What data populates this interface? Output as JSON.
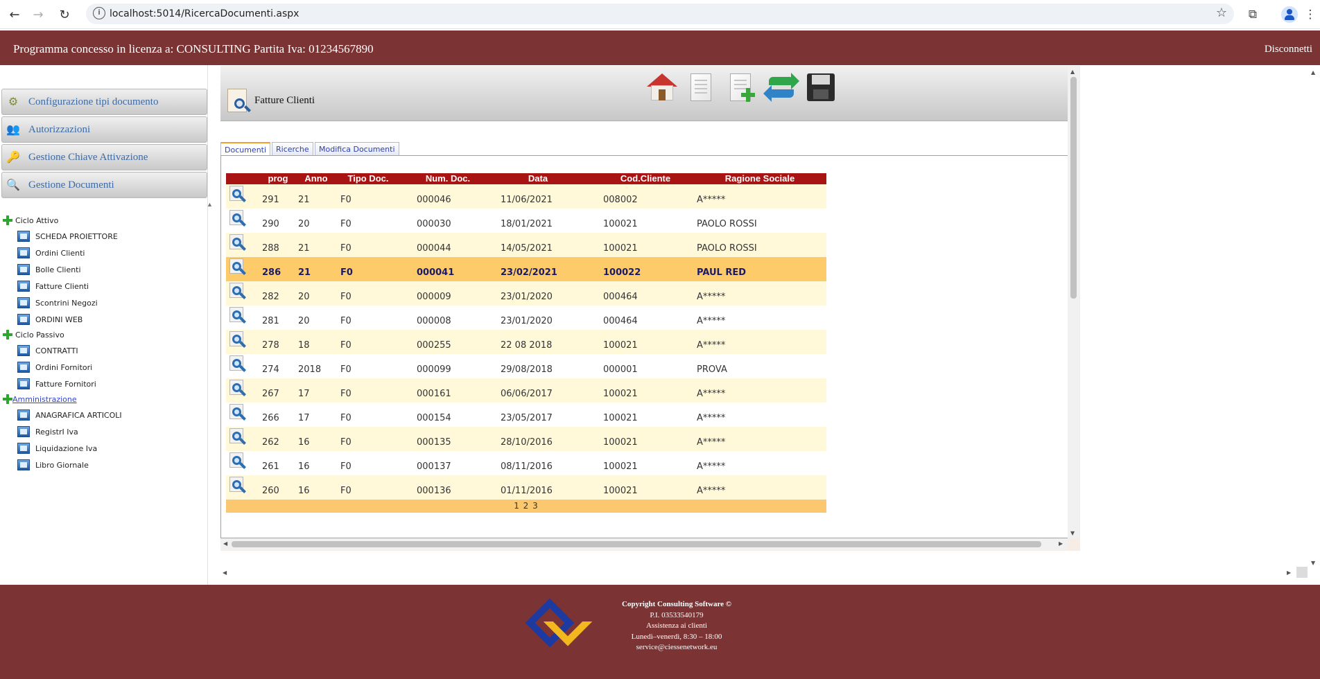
{
  "browser": {
    "url": "localhost:5014/RicercaDocumenti.aspx"
  },
  "header": {
    "license_text": "Programma concesso in licenza a: CONSULTING Partita Iva: 01234567890",
    "logout_label": "Disconnetti"
  },
  "sidebar": {
    "menu": [
      {
        "label": "Configurazione tipi documento",
        "icon": "gear-icon"
      },
      {
        "label": "Autorizzazioni",
        "icon": "users-icon"
      },
      {
        "label": "Gestione Chiave Attivazione",
        "icon": "key-icon"
      },
      {
        "label": "Gestione Documenti",
        "icon": "search-document-icon"
      }
    ],
    "groups": [
      {
        "label": "Ciclo Attivo",
        "items": [
          "SCHEDA PROIETTORE",
          "Ordini Clienti",
          "Bolle Clienti",
          "Fatture Clienti",
          "Scontrini Negozi",
          "ORDINI WEB"
        ]
      },
      {
        "label": "Ciclo Passivo",
        "items": [
          "CONTRATTI",
          "Ordini Fornitori",
          "Fatture Fornitori"
        ]
      },
      {
        "label": "Amministrazione",
        "items": [
          "ANAGRAFICA ARTICOLI",
          "RegistrI Iva",
          "Liquidazione Iva",
          "Libro Giornale"
        ]
      }
    ]
  },
  "page": {
    "title": "Fatture Clienti",
    "toolbar": [
      "home-icon",
      "new-document-icon",
      "add-document-icon",
      "refresh-icon",
      "save-icon"
    ]
  },
  "tabs": [
    {
      "label": "Documenti",
      "active": true
    },
    {
      "label": "Ricerche",
      "active": false
    },
    {
      "label": "Modifica Documenti",
      "active": false
    }
  ],
  "table": {
    "columns": [
      "prog",
      "Anno",
      "Tipo Doc.",
      "Num. Doc.",
      "Data",
      "Cod.Cliente",
      "Ragione Sociale"
    ],
    "rows": [
      [
        "291",
        "21",
        "F0",
        "000046",
        "11/06/2021",
        "008002",
        "A*****"
      ],
      [
        "290",
        "20",
        "F0",
        "000030",
        "18/01/2021",
        "100021",
        "PAOLO ROSSI"
      ],
      [
        "288",
        "21",
        "F0",
        "000044",
        "14/05/2021",
        "100021",
        "PAOLO ROSSI"
      ],
      [
        "286",
        "21",
        "F0",
        "000041",
        "23/02/2021",
        "100022",
        "PAUL RED"
      ],
      [
        "282",
        "20",
        "F0",
        "000009",
        "23/01/2020",
        "000464",
        "A*****"
      ],
      [
        "281",
        "20",
        "F0",
        "000008",
        "23/01/2020",
        "000464",
        "A*****"
      ],
      [
        "278",
        "18",
        "F0",
        "000255",
        "22 08 2018",
        "100021",
        "A*****"
      ],
      [
        "274",
        "2018",
        "F0",
        "000099",
        "29/08/2018",
        "000001",
        "PROVA"
      ],
      [
        "267",
        "17",
        "F0",
        "000161",
        "06/06/2017",
        "100021",
        "A*****"
      ],
      [
        "266",
        "17",
        "F0",
        "000154",
        "23/05/2017",
        "100021",
        "A*****"
      ],
      [
        "262",
        "16",
        "F0",
        "000135",
        "28/10/2016",
        "100021",
        "A*****"
      ],
      [
        "261",
        "16",
        "F0",
        "000137",
        "08/11/2016",
        "100021",
        "A*****"
      ],
      [
        "260",
        "16",
        "F0",
        "000136",
        "01/11/2016",
        "100021",
        "A*****"
      ]
    ],
    "selected_row": 3,
    "pager": "1 2 3"
  },
  "footer": {
    "lines": [
      "Copyright Consulting Software ©",
      "P.I. 03533540179",
      "Assistenza ai clienti",
      "Lunedì–venerdì, 8:30 – 18:00",
      "service@ciessenetwork.eu"
    ]
  }
}
